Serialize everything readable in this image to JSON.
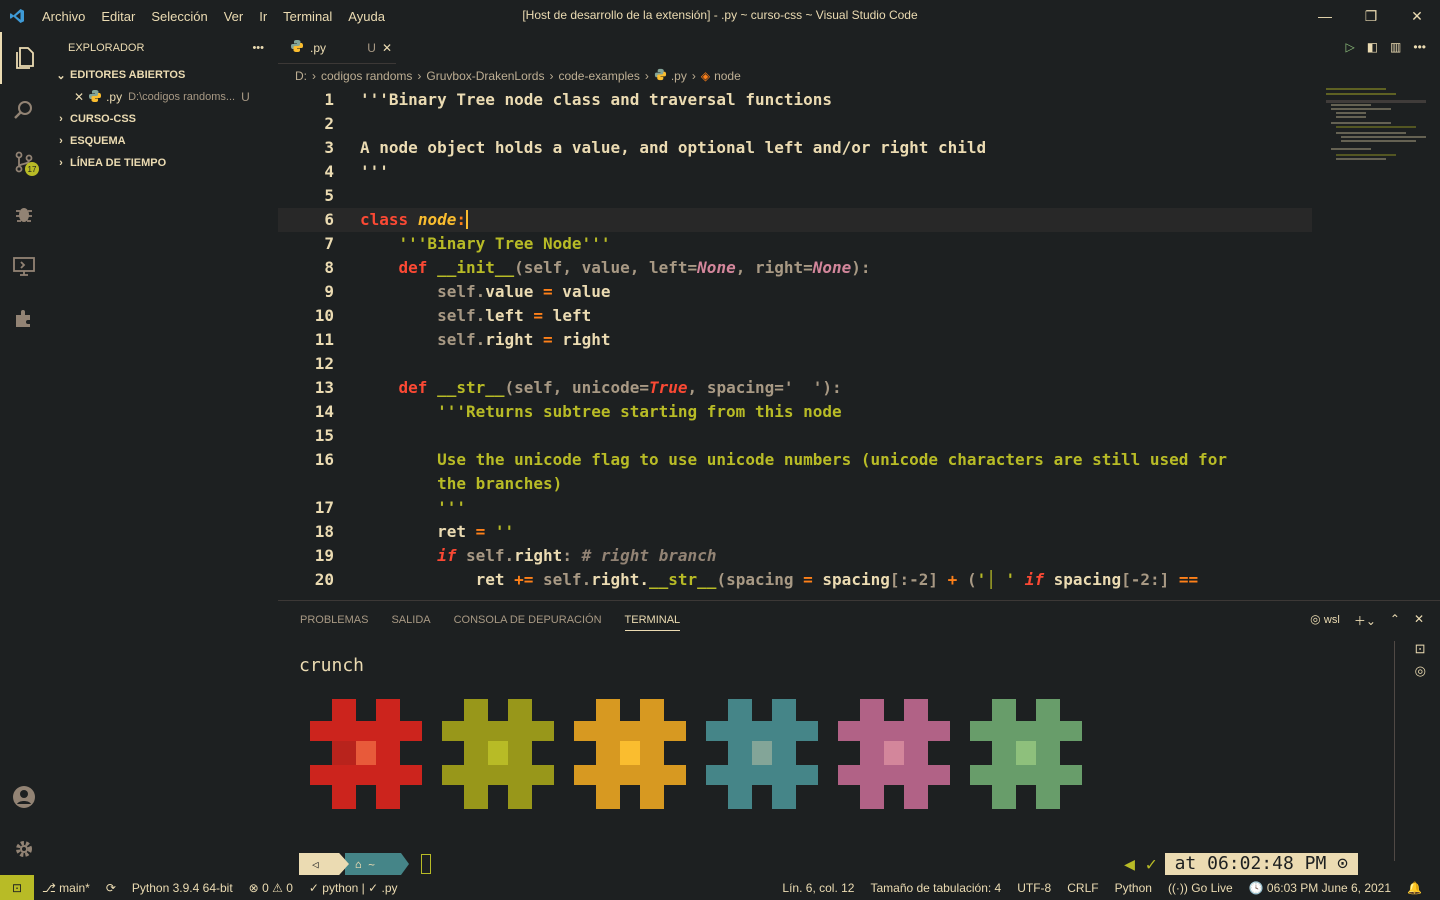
{
  "titlebar": {
    "menu": [
      "Archivo",
      "Editar",
      "Selección",
      "Ver",
      "Ir",
      "Terminal",
      "Ayuda"
    ],
    "title": "[Host de desarrollo de la extensión] - .py ~ curso-css ~ Visual Studio Code"
  },
  "activity": {
    "scm_badge": "17"
  },
  "sidebar": {
    "title": "EXPLORADOR",
    "open_editors": "EDITORES ABIERTOS",
    "open_file_name": ".py",
    "open_file_path": "D:\\codigos randoms...",
    "open_file_status": "U",
    "sections": [
      "CURSO-CSS",
      "ESQUEMA",
      "LÍNEA DE TIEMPO"
    ]
  },
  "editor": {
    "tab_name": ".py",
    "tab_status": "U",
    "breadcrumb": [
      "D:",
      "codigos randoms",
      "Gruvbox-DrakenLords",
      "code-examples",
      ".py",
      "node"
    ],
    "line_numbers": [
      "1",
      "2",
      "3",
      "4",
      "5",
      "6",
      "7",
      "8",
      "9",
      "10",
      "11",
      "12",
      "13",
      "14",
      "15",
      "16",
      "",
      "17",
      "18",
      "19",
      "20"
    ]
  },
  "panel": {
    "tabs": [
      "PROBLEMAS",
      "SALIDA",
      "CONSOLA DE DEPURACIÓN",
      "TERMINAL"
    ],
    "shell": "wsl",
    "title": "crunch",
    "time": "at 06:02:48 PM"
  },
  "colors": {
    "accent": "#b8bb26",
    "red": "#cc241d",
    "yellow": "#98971a",
    "orange": "#d79921",
    "teal": "#458588",
    "pink": "#b16286",
    "green": "#689d6a"
  },
  "status": {
    "branch": "main*",
    "python": "Python 3.9.4 64-bit",
    "errors": "0",
    "warnings": "0",
    "check": "python | ✓ .py",
    "position": "Lín. 6, col. 12",
    "tab_size": "Tamaño de tabulación: 4",
    "encoding": "UTF-8",
    "eol": "CRLF",
    "language": "Python",
    "golive": "Go Live",
    "time": "06:03 PM",
    "date": "June 6, 2021"
  }
}
